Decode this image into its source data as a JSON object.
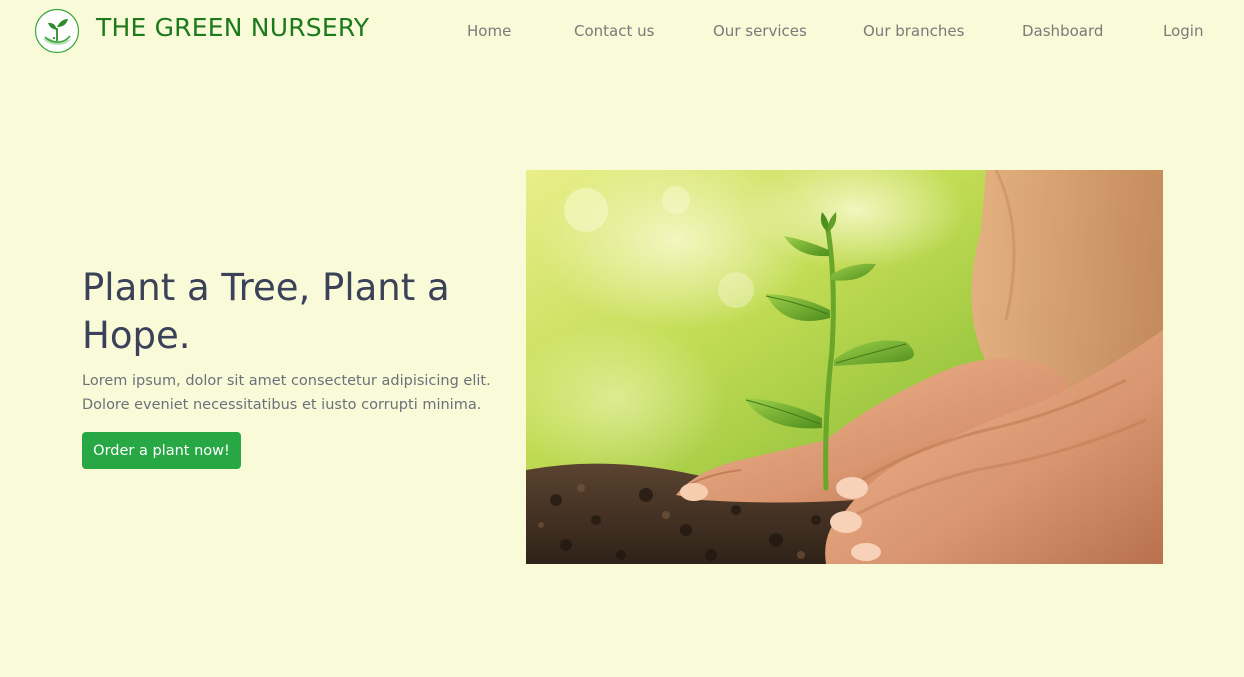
{
  "brand": {
    "name": "THE GREEN NURSERY",
    "logo_icon": "sprout-in-hand-icon",
    "color": "#1c7a1c"
  },
  "nav": {
    "items": [
      {
        "label": "Home"
      },
      {
        "label": "Contact us"
      },
      {
        "label": "Our services"
      },
      {
        "label": "Our branches"
      },
      {
        "label": "Dashboard"
      },
      {
        "label": "Login"
      }
    ]
  },
  "hero": {
    "title": "Plant a Tree, Plant a Hope.",
    "description": "Lorem ipsum, dolor sit amet consectetur adipisicing elit. Dolore eveniet necessitatibus et iusto corrupti minima.",
    "cta_label": "Order a plant now!",
    "image_subject": "seedling-planted-by-hands"
  },
  "colors": {
    "background": "#f8fad8",
    "accent": "#28a745",
    "heading": "#3a4158",
    "nav_text": "#7a7a7a"
  }
}
